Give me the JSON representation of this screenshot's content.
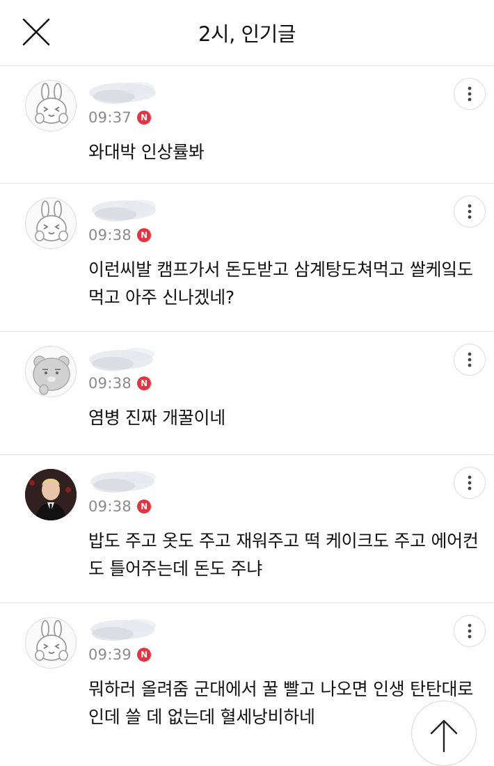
{
  "header": {
    "title": "2시, 인기글"
  },
  "comments": [
    {
      "time": "09:37",
      "badge": "N",
      "text": "와대박 인상률봐",
      "avatar": "rabbit-avatar"
    },
    {
      "time": "09:38",
      "badge": "N",
      "text": "이런씨발 캠프가서 돈도받고 삼계탕도쳐먹고 쌀케잌도 먹고 아주 신나겠네?",
      "avatar": "rabbit-avatar"
    },
    {
      "time": "09:38",
      "badge": "N",
      "text": "염병 진짜 개꿀이네",
      "avatar": "bear-avatar"
    },
    {
      "time": "09:38",
      "badge": "N",
      "text": "밥도 주고 옷도 주고 재워주고 떡 케이크도 주고 에어컨도 틀어주는데 돈도 주냐",
      "avatar": "photo-avatar"
    },
    {
      "time": "09:39",
      "badge": "N",
      "text": "뭐하러 올려줌 군대에서 꿀 빨고 나오면 인생 탄탄대로인데 쓸 데 없는데 혈세낭비하네",
      "avatar": "rabbit-avatar"
    }
  ],
  "colors": {
    "badge": "#e8323f",
    "time": "#8a8a8a",
    "divider": "#e6e6e6"
  },
  "icons": {
    "close": "close-icon",
    "more": "more-vertical-icon",
    "scroll_top": "arrow-up-icon"
  }
}
